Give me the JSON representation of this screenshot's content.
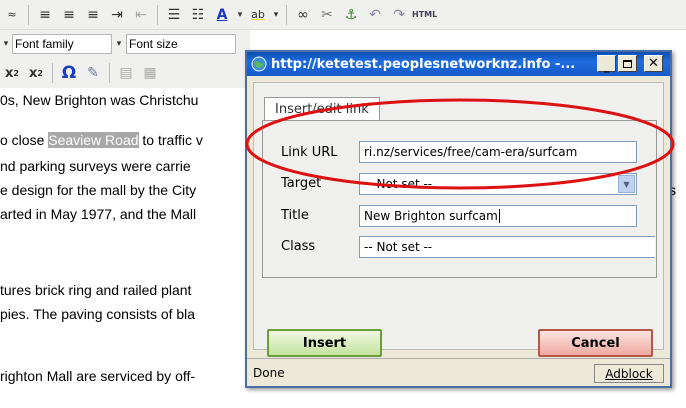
{
  "editor": {
    "toolbar_font_family": "Font family",
    "toolbar_font_size": "Font size",
    "content": [
      {
        "pre": "0s, New Brighton was Christchu",
        "hl": "",
        "post": ""
      },
      {
        "pre": "o close ",
        "hl": "Seaview Road",
        "post": " to traffic v"
      },
      {
        "pre": "nd parking surveys were carrie",
        "hl": "",
        "post": ""
      },
      {
        "pre": "e design for the mall by the City",
        "hl": "",
        "post": ""
      },
      {
        "pre": "arted in May 1977, and the Mall",
        "hl": "",
        "post": ""
      },
      {
        "pre": "tures brick ring and railed plant",
        "hl": "",
        "post": ""
      },
      {
        "pre": "pies. The paving consists of bla",
        "hl": "",
        "post": ""
      },
      {
        "pre": "righton Mall are serviced by off-",
        "hl": "",
        "post": ""
      }
    ],
    "right_fragment": "s"
  },
  "popup": {
    "title": "http://ketetest.peoplesnetworknz.info -...",
    "tab_label": "Insert/edit link",
    "fields": {
      "link_url_label": "Link URL",
      "link_url_value": "ri.nz/services/free/cam-era/surfcam",
      "target_label": "Target",
      "target_value": "-- Not set --",
      "title_label": "Title",
      "title_value": "New Brighton surfcam",
      "class_label": "Class",
      "class_value": "-- Not set --"
    },
    "insert_label": "Insert",
    "cancel_label": "Cancel",
    "status_text": "Done",
    "adblock_label": "Adblock"
  },
  "colors": {
    "title_bar": "#1459c8",
    "annotation": "#dd1111",
    "highlight": "#a8a8a8"
  }
}
